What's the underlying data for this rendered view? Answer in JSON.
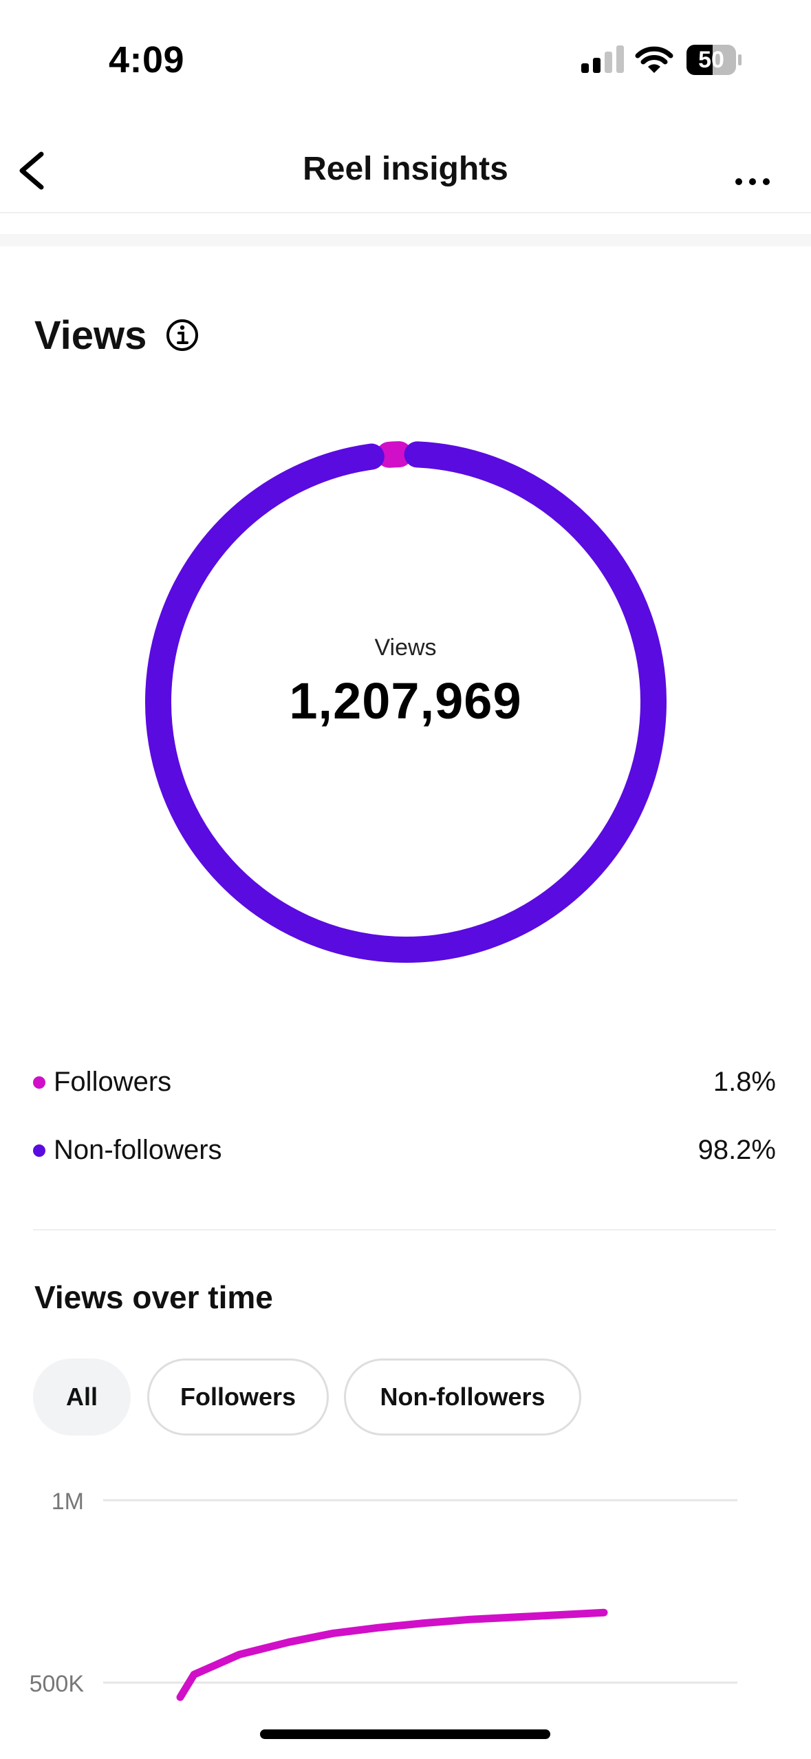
{
  "status_bar": {
    "time": "4:09",
    "battery_level": "50"
  },
  "header": {
    "title": "Reel insights"
  },
  "views": {
    "title": "Views",
    "donut_label": "Views",
    "total": "1,207,969",
    "legend": [
      {
        "label": "Followers",
        "value": "1.8%",
        "color": "#d10fc8"
      },
      {
        "label": "Non-followers",
        "value": "98.2%",
        "color": "#5a0be0"
      }
    ]
  },
  "over_time": {
    "title": "Views over time",
    "filters": [
      {
        "label": "All",
        "selected": true
      },
      {
        "label": "Followers",
        "selected": false
      },
      {
        "label": "Non-followers",
        "selected": false
      }
    ]
  },
  "chart_data": [
    {
      "type": "pie",
      "categories": [
        "Followers",
        "Non-followers"
      ],
      "values": [
        1.8,
        98.2
      ],
      "colors": [
        "#d10fc8",
        "#5a0be0"
      ]
    },
    {
      "type": "line",
      "y_ticks": [
        "1M",
        "500K"
      ],
      "ylim": [
        0,
        1000000
      ],
      "series": [
        {
          "color": "#d10fc8",
          "points": [
            {
              "x": 0,
              "y": 460000
            },
            {
              "x": 1,
              "y": 522000
            },
            {
              "x": 2,
              "y": 577000
            },
            {
              "x": 3,
              "y": 611000
            },
            {
              "x": 4,
              "y": 635000
            },
            {
              "x": 5,
              "y": 651000
            },
            {
              "x": 6,
              "y": 663000
            },
            {
              "x": 7,
              "y": 673000
            },
            {
              "x": 8,
              "y": 683000
            },
            {
              "x": 9,
              "y": 692000
            }
          ]
        }
      ]
    }
  ]
}
